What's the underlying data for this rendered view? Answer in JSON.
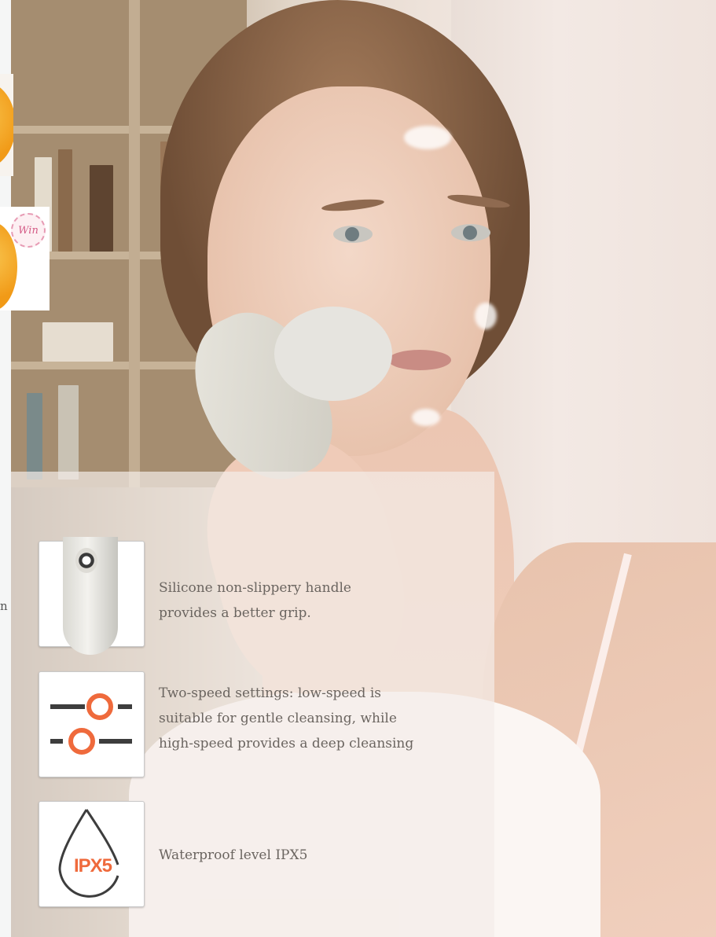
{
  "promos": {
    "badge_text": "Win"
  },
  "left_fragment": "n",
  "features": [
    {
      "icon": "handle-grip-icon",
      "text_line1": "Silicone non-slippery handle",
      "text_line2": "provides a better grip."
    },
    {
      "icon": "speed-settings-icon",
      "text_line1": "Two-speed settings: low-speed is",
      "text_line2": "suitable for gentle cleansing, while",
      "text_line3": "high-speed provides a deep cleansing"
    },
    {
      "icon": "waterproof-drop-icon",
      "icon_label": "IPX5",
      "text_line1": "Waterproof level IPX5"
    }
  ],
  "colors": {
    "accent_orange": "#ef6a3c",
    "icon_dark": "#3d3d3d",
    "text_muted": "#6b6560"
  }
}
